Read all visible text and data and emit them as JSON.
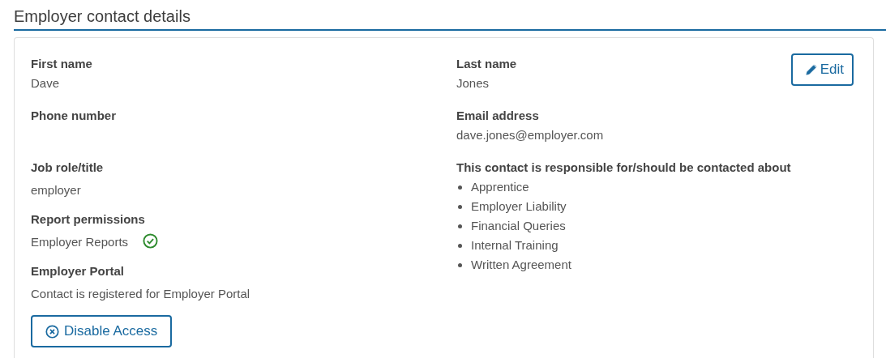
{
  "heading": "Employer contact details",
  "edit_button": {
    "label": "Edit"
  },
  "fields": [
    {
      "label": "First name",
      "value": "Dave"
    },
    {
      "label": "Last name",
      "value": "Jones"
    },
    {
      "label": "Phone number"
    },
    {
      "label": "Email address",
      "value": "dave.jones@employer.com"
    }
  ],
  "left_details": [
    {
      "label": "Job role/title",
      "value": "employer"
    },
    {
      "label": "Report permissions",
      "value": "Employer Reports",
      "granted": true
    },
    {
      "label": "Employer Portal",
      "value": "Contact is registered for Employer Portal"
    }
  ],
  "responsibilities": {
    "label": "This contact is responsible for/should be contacted about",
    "items": [
      "Apprentice",
      "Employer Liability",
      "Financial Queries",
      "Internal Training",
      "Written Agreement"
    ]
  },
  "disable_button": {
    "label": "Disable Access"
  }
}
